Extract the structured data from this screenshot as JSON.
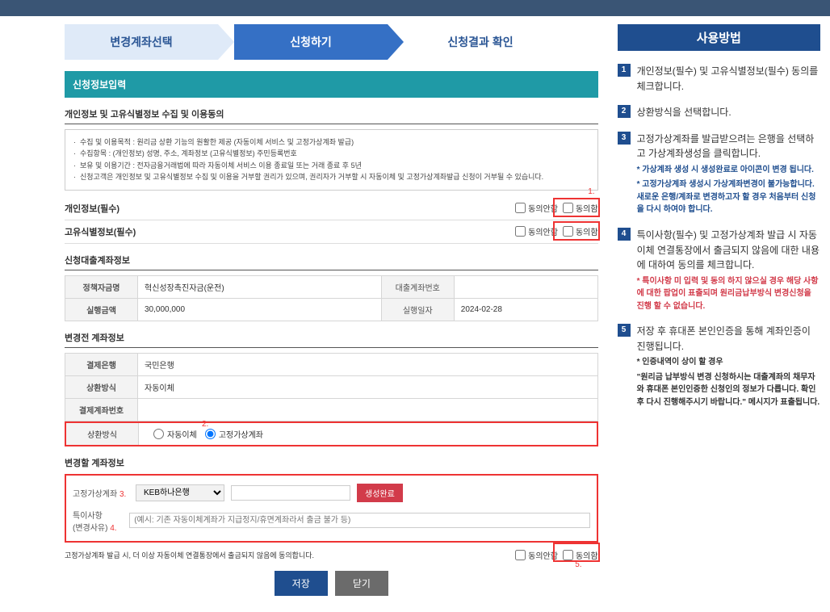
{
  "steps": {
    "s1": "변경계좌선택",
    "s2": "신청하기",
    "s3": "신청결과 확인"
  },
  "section_header": "신청정보입력",
  "consent_heading": "개인정보 및 고유식별정보 수집 및 이용동의",
  "info_lines": [
    "수집 및 이용목적 : 원리금 상환 기능의 원활한 제공 (자동이체 서비스 및 고정가상계좌 발급)",
    "수집항목 : (개인정보) 성명, 주소, 계좌정보 (고유식별정보) 주민등록번호",
    "보유 및 이용기간 : 전자금융거래법에 따라 자동이체 서비스 이용 종료일 또는 거래 종료 후 5년",
    "신청고객은 개인정보 및 고유식별정보 수집 및 이용을 거부할 권리가 있으며, 권리자가 거부할 시 자동이체 및 고정가상계좌발급 신청이 거부될 수 있습니다."
  ],
  "consent1": {
    "label": "개인정보(필수)",
    "no": "동의안함",
    "yes": "동의함"
  },
  "consent2": {
    "label": "고유식별정보(필수)",
    "no": "동의안함",
    "yes": "동의함"
  },
  "rednums": {
    "n1": "1.",
    "n2": "2.",
    "n3": "3.",
    "n4": "4.",
    "n5": "5."
  },
  "loan_head": "신청대출계좌정보",
  "loan": {
    "fund_k": "정책자금명",
    "fund_v": "혁신성장촉진자금(운전)",
    "acct_k": "대출계좌번호",
    "acct_v": "",
    "amt_k": "실행금액",
    "amt_v": "30,000,000",
    "date_k": "실행일자",
    "date_v": "2024-02-28"
  },
  "before_head": "변경전 계좌정보",
  "before": {
    "bank_k": "결제은행",
    "bank_v": "국민은행",
    "method_k": "상환방식",
    "method_v": "자동이체",
    "acct_k": "결제계좌번호",
    "acct_v": ""
  },
  "method_head": "상환방식",
  "method_opts": {
    "auto": "자동이체",
    "fixed": "고정가상계좌"
  },
  "after_head": "변경할 계좌정보",
  "after": {
    "fixed_k": "고정가상계좌",
    "bank_selected": "KEB하나은행",
    "gen_btn": "생성완료",
    "reason_k": "특이사항\n(변경사유)",
    "reason_placeholder": "(예시: 기존 자동이체계좌가 지급정지/휴면계좌라서 출금 불가 등)"
  },
  "consent3_text": "고정가상계좌 발급 시, 더 이상 자동이체 연결통장에서 출금되지 않음에 동의합니다.",
  "consent3": {
    "no": "동의안함",
    "yes": "동의함"
  },
  "buttons": {
    "save": "저장",
    "close": "닫기"
  },
  "side": {
    "title": "사용방법",
    "items": [
      {
        "n": "1",
        "t": "개인정보(필수) 및 고유식별정보(필수) 동의를 체크합니다."
      },
      {
        "n": "2",
        "t": "상환방식을 선택합니다."
      },
      {
        "n": "3",
        "t": "고정가상계좌를 발급받으려는 은행을 선택하고 가상계좌생성을 클릭합니다.",
        "notes": [
          "* 가상계좌 생성 시 생성완료로 아이콘이 변경 됩니다.",
          "* 고정가상계좌 생성시 가상계좌변경이 불가능합니다. 새로운 은행/계좌로 변경하고자 할 경우 처음부터 신청을 다시 하여야 합니다."
        ]
      },
      {
        "n": "4",
        "t": "특이사항(필수) 및 고정가상계좌 발급 시 자동이체 연결통장에서 출금되지 않음에 대한 내용에 대하여 동의를 체크합니다.",
        "rednote": "* 특이사항 미 입력 및 동의 하지 않으실 경우 해당 사항에 대한 팝업이 표출되며 원리금납부방식 변경신청을 진행 할 수 없습니다."
      },
      {
        "n": "5",
        "t": "저장 후 휴대폰 본인인증을 통해 계좌인증이 진행됩니다.",
        "sub": "* 인증내역이 상이 할 경우",
        "quote": "\"원리금 납부방식 변경 신청하시는 대출계좌의 채무자와 휴대폰 본인인증한 신청인의 정보가 다릅니다. 확인 후 다시 진행해주시기 바랍니다.\" 메시지가 표출됩니다."
      }
    ]
  }
}
